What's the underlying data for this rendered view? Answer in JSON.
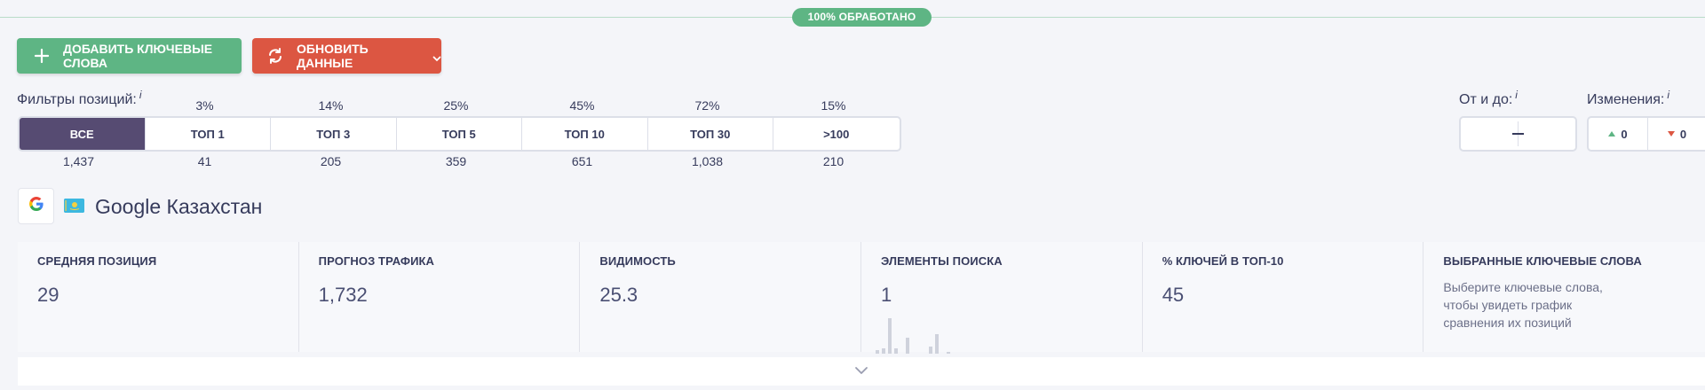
{
  "progress": {
    "label": "100% ОБРАБОТАНО",
    "value": 100
  },
  "toolbar": {
    "add_label": "ДОБАВИТЬ КЛЮЧЕВЫЕ СЛОВА",
    "refresh_label": "ОБНОВИТЬ ДАННЫЕ"
  },
  "filters": {
    "label": "Фильтры позиций:",
    "info": "i",
    "items": [
      {
        "label": "ВСЕ",
        "percent": "",
        "count": "1,437"
      },
      {
        "label": "ТОП 1",
        "percent": "3%",
        "count": "41"
      },
      {
        "label": "ТОП 3",
        "percent": "14%",
        "count": "205"
      },
      {
        "label": "ТОП 5",
        "percent": "25%",
        "count": "359"
      },
      {
        "label": "ТОП 10",
        "percent": "45%",
        "count": "651"
      },
      {
        "label": "ТОП 30",
        "percent": "72%",
        "count": "1,038"
      },
      {
        "label": ">100",
        "percent": "15%",
        "count": "210"
      }
    ]
  },
  "range": {
    "label": "От и до:",
    "info": "i"
  },
  "changes": {
    "label": "Изменения:",
    "info": "i",
    "up": "0",
    "down": "0"
  },
  "engine": {
    "title": "Google Казахстан"
  },
  "stats": [
    {
      "title": "СРЕДНЯЯ ПОЗИЦИЯ",
      "value": "29",
      "desc": ""
    },
    {
      "title": "ПРОГНОЗ ТРАФИКА",
      "value": "1,732",
      "desc": ""
    },
    {
      "title": "ВИДИМОСТЬ",
      "value": "25.3",
      "desc": ""
    },
    {
      "title": "ЭЛЕМЕНТЫ ПОИСКА",
      "value": "1",
      "desc": ""
    },
    {
      "title": "% КЛЮЧЕЙ В ТОП-10",
      "value": "45",
      "desc": ""
    },
    {
      "title": "ВЫБРАННЫЕ КЛЮЧЕВЫЕ СЛОВА",
      "value": "",
      "desc": "Выберите ключевые слова, чтобы увидеть график сравнения их позиций"
    }
  ],
  "colors": {
    "green": "#5eb584",
    "red": "#dc5642",
    "active_purple": "#564b72",
    "text": "#363b5c"
  },
  "icons": [
    "plus-icon",
    "refresh-icon",
    "chevron-down-icon",
    "google-g-icon",
    "kazakhstan-flag-icon",
    "triangle-up-icon",
    "triangle-down-icon",
    "expand-chevron-icon"
  ]
}
